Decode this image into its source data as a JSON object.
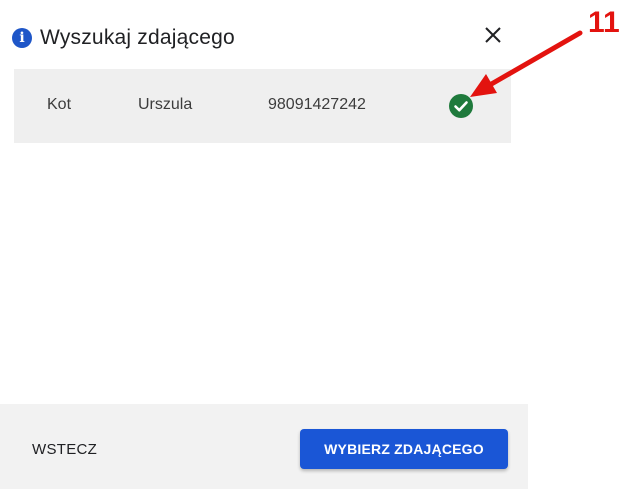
{
  "dialog": {
    "title": "Wyszukaj zdającego",
    "info_icon": "info-icon",
    "close_icon": "close-icon"
  },
  "result": {
    "last_name": "Kot",
    "first_name": "Urszula",
    "pesel": "98091427242",
    "status_icon": "check-circle-icon",
    "status_color": "#1f7a3c"
  },
  "annotation": {
    "number": "11",
    "color": "#e3130f"
  },
  "footer": {
    "back_label": "WSTECZ",
    "select_label": "WYBIERZ ZDAJĄCEGO",
    "accent_color": "#1a56d6"
  }
}
